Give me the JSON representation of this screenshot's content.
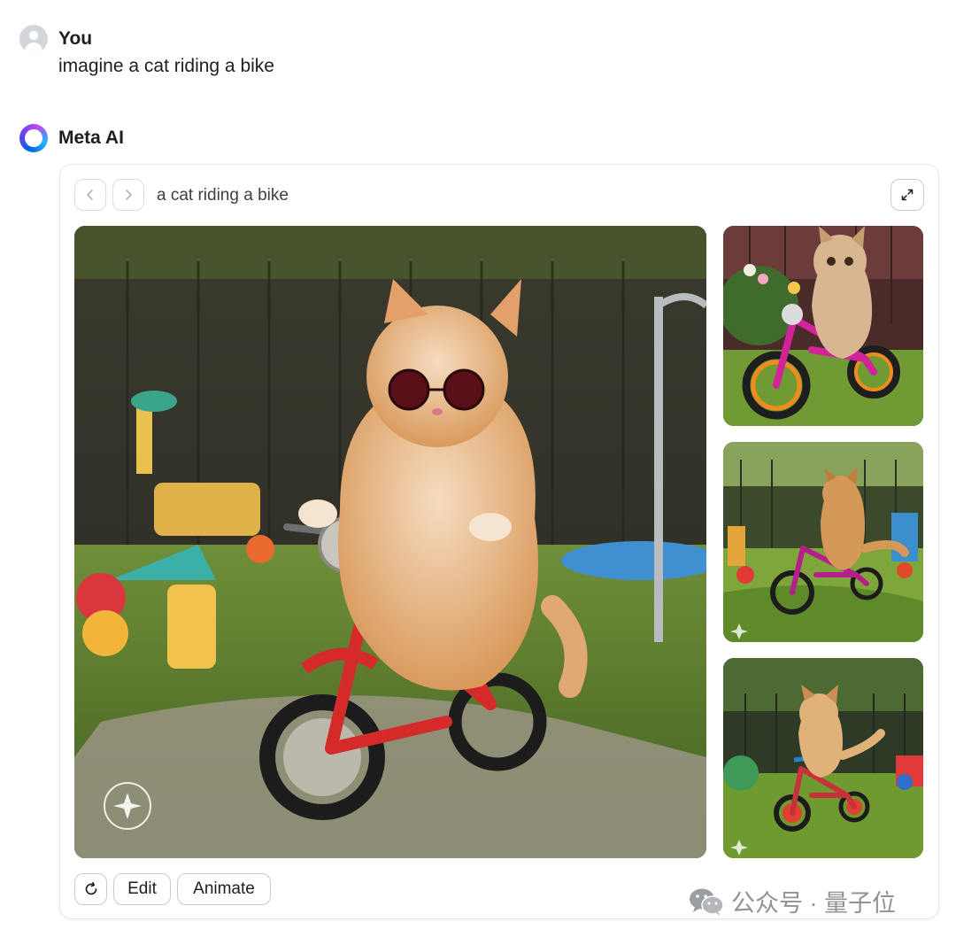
{
  "user_message": {
    "name": "You",
    "text": "imagine a cat riding a bike"
  },
  "ai_message": {
    "name": "Meta AI"
  },
  "image_card": {
    "prompt_title": "a cat riding a bike",
    "actions": {
      "edit_label": "Edit",
      "animate_label": "Animate"
    }
  },
  "watermark": {
    "text": "公众号 · 量子位"
  },
  "icons": {
    "user_avatar": "user-avatar-icon",
    "meta_ai_logo": "meta-ai-ring-icon",
    "prev": "chevron-left-icon",
    "next": "chevron-right-icon",
    "expand": "expand-icon",
    "regenerate": "refresh-icon",
    "wechat": "wechat-icon"
  },
  "colors": {
    "accent": "#0064e0",
    "border": "#dadde1",
    "text": "#1c1e21",
    "muted": "#3c4043"
  }
}
